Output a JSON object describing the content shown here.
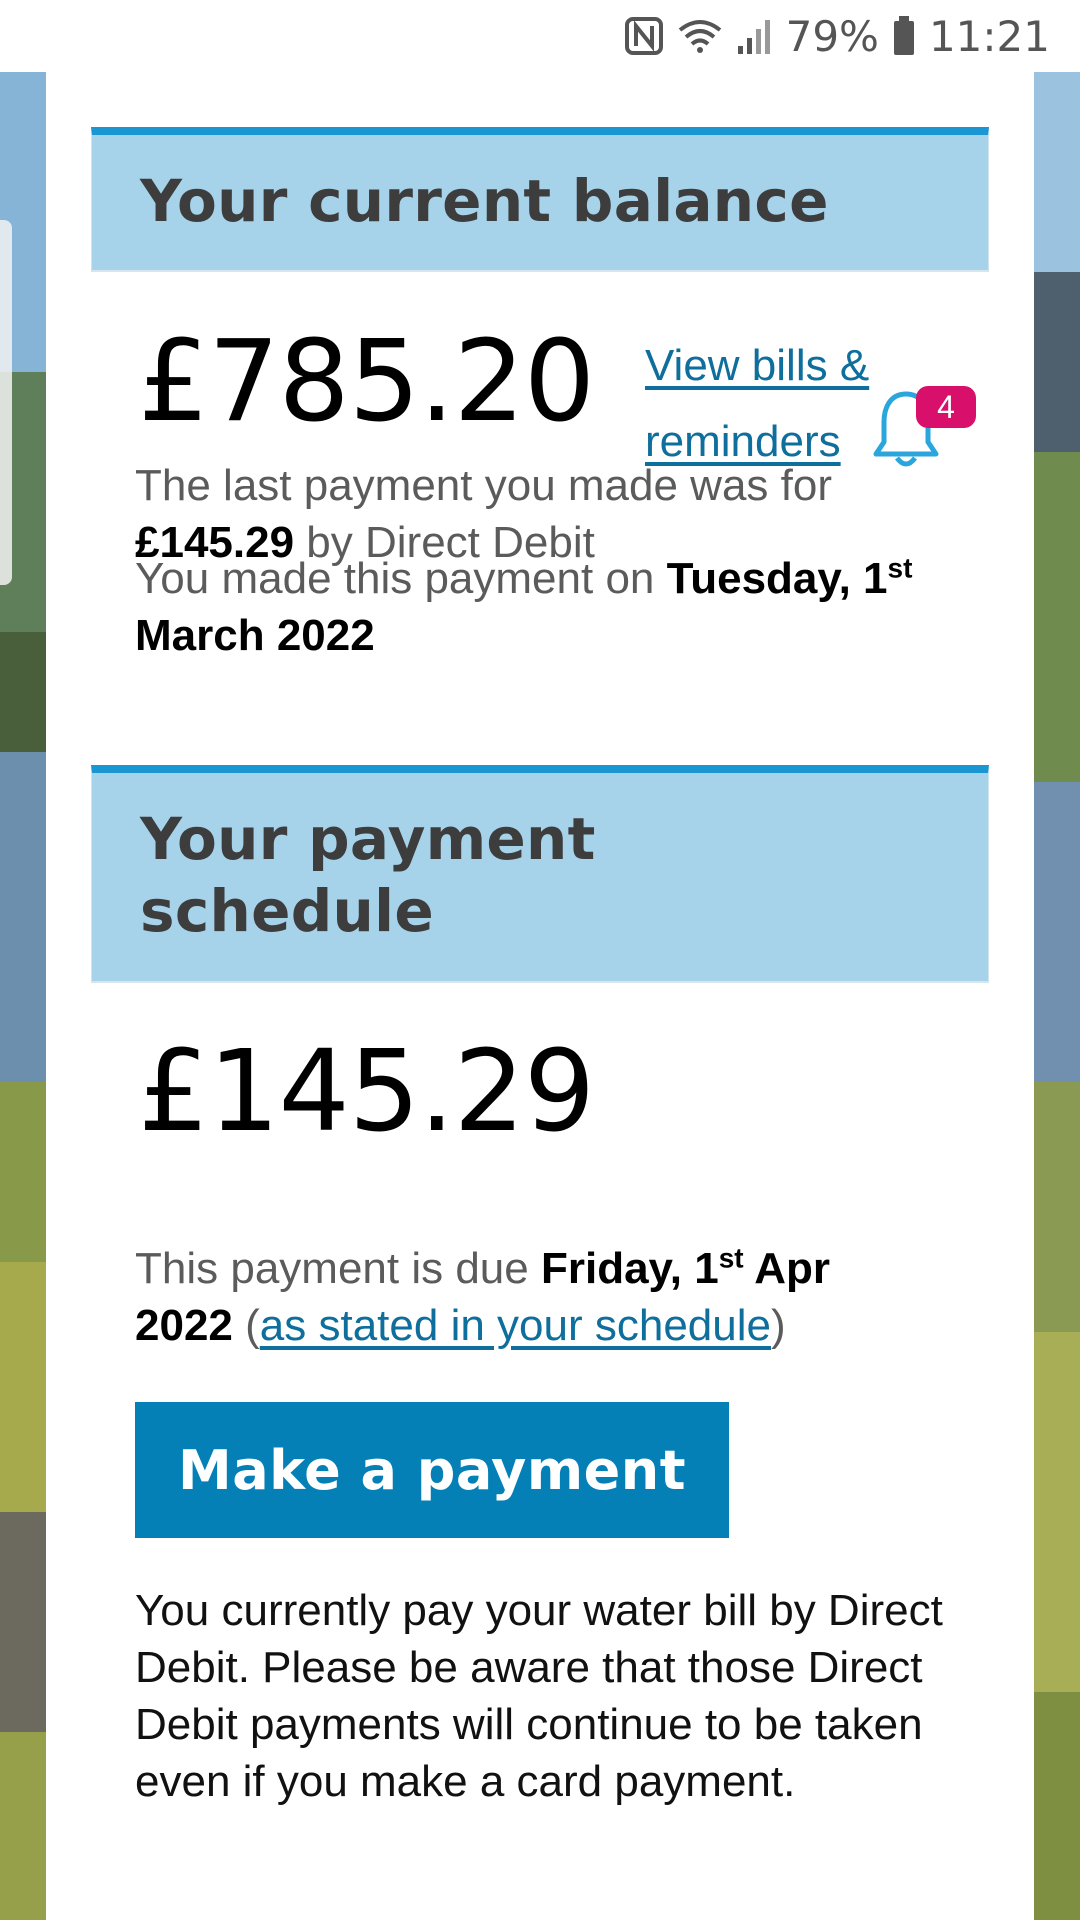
{
  "status_bar": {
    "battery": "79%",
    "time": "11:21",
    "icons": [
      "nfc-icon",
      "wifi-icon",
      "signal-icon",
      "battery-icon"
    ]
  },
  "balance": {
    "heading": "Your current balance",
    "amount": "£785.20",
    "bills_link": "View bills & reminders",
    "notification_count": "4",
    "last_payment_prefix": "The last payment you made was for",
    "last_payment_amount": "£145.29",
    "last_payment_method": "by Direct Debit",
    "payment_date_prefix": "You made this payment on",
    "payment_date_day": "Tuesday, 1",
    "payment_date_suffix": "st",
    "payment_date_rest": "March 2022"
  },
  "schedule": {
    "heading": "Your payment schedule",
    "amount": "£145.29",
    "due_prefix": "This payment is due",
    "due_day": "Friday, 1",
    "due_suffix": "st",
    "due_rest": "Apr 2022",
    "open_paren": "(",
    "schedule_link": "as stated in your schedule",
    "close_paren": ")"
  },
  "action": {
    "make_payment_label": "Make a payment"
  },
  "notice": {
    "text": "You currently pay your water bill by Direct Debit. Please be aware that those Direct Debit payments will continue to be taken even if you make a card payment."
  },
  "colors": {
    "header_bg": "#a6d3ea",
    "header_rule": "#1a96d2",
    "button": "#0580b6",
    "link": "#0e6e9c",
    "badge": "#d8106b"
  }
}
